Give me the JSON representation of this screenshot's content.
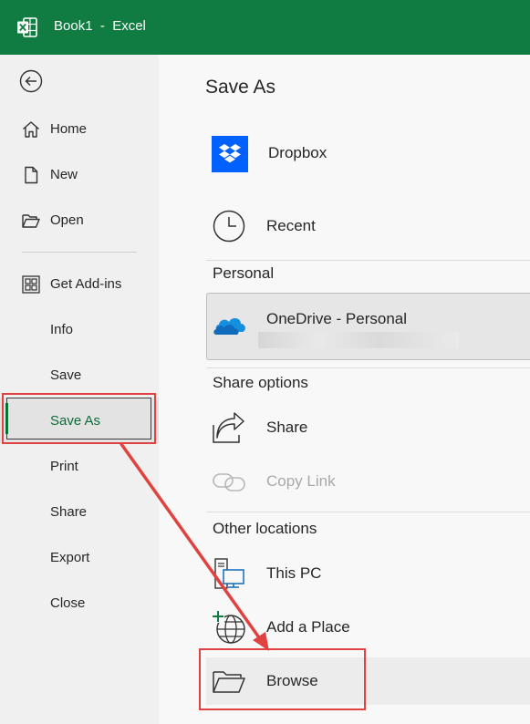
{
  "window": {
    "title": "Book1  -  Excel"
  },
  "sidebar": {
    "items": [
      {
        "label": "Home",
        "icon": "home-icon"
      },
      {
        "label": "New",
        "icon": "new-document-icon"
      },
      {
        "label": "Open",
        "icon": "open-folder-icon"
      },
      {
        "label": "Get Add-ins",
        "icon": "add-ins-grid-icon"
      },
      {
        "label": "Info"
      },
      {
        "label": "Save"
      },
      {
        "label": "Save As",
        "active": true
      },
      {
        "label": "Print"
      },
      {
        "label": "Share"
      },
      {
        "label": "Export"
      },
      {
        "label": "Close"
      }
    ]
  },
  "main": {
    "title": "Save As",
    "locations": {
      "dropbox": "Dropbox",
      "recent": "Recent"
    },
    "personal": {
      "heading": "Personal",
      "onedrive": "OneDrive - Personal"
    },
    "share_options": {
      "heading": "Share options",
      "share": "Share",
      "copy_link": "Copy Link"
    },
    "other_locations": {
      "heading": "Other locations",
      "this_pc": "This PC",
      "add_place": "Add a Place",
      "browse": "Browse"
    }
  },
  "colors": {
    "excel_green": "#107c41",
    "highlight_red": "#e0433f",
    "dropbox_blue": "#0061fe",
    "onedrive_blue": "#0f6cbd"
  }
}
